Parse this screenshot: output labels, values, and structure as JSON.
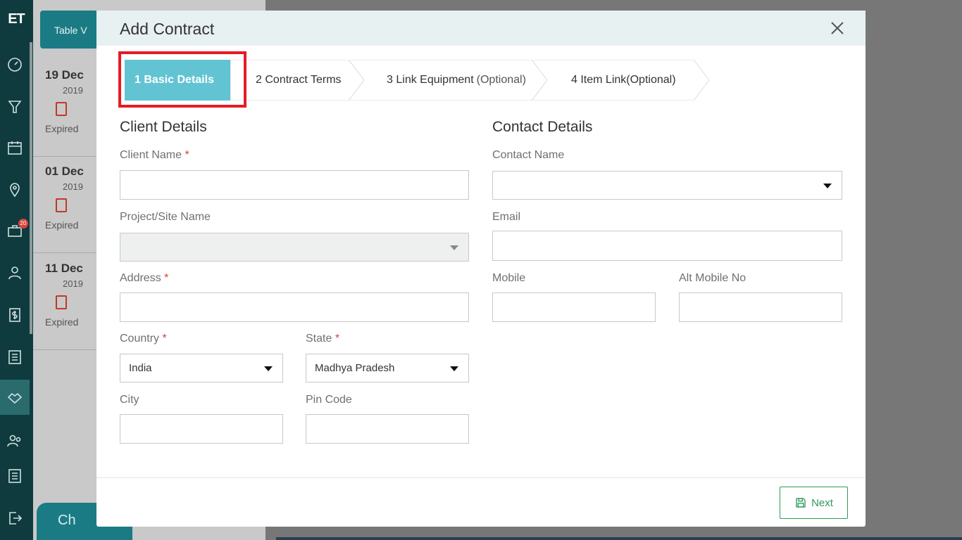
{
  "app": {
    "logo": "ET",
    "table_view_label": "Table V",
    "chat_label": "Ch",
    "notification_count": "20"
  },
  "cards": [
    {
      "date": "19 Dec",
      "year": "2019",
      "status": "Expired"
    },
    {
      "date": "01 Dec",
      "year": "2019",
      "status": "Expired"
    },
    {
      "date": "11 Dec",
      "year": "2019",
      "status": "Expired"
    }
  ],
  "modal": {
    "title": "Add Contract",
    "steps": [
      {
        "num": "1",
        "label": "Basic Details",
        "optional": ""
      },
      {
        "num": "2",
        "label": "Contract Terms",
        "optional": ""
      },
      {
        "num": "3",
        "label": "Link Equipment",
        "optional": "(Optional)"
      },
      {
        "num": "4",
        "label": "Item Link",
        "optional": "(Optional)"
      }
    ],
    "client": {
      "title": "Client Details",
      "client_name_label": "Client Name",
      "client_name_value": "",
      "project_label": "Project/Site Name",
      "project_value": "",
      "address_label": "Address",
      "address_value": "",
      "country_label": "Country",
      "country_value": "India",
      "state_label": "State",
      "state_value": "Madhya Pradesh",
      "city_label": "City",
      "city_value": "",
      "pin_label": "Pin Code",
      "pin_value": ""
    },
    "contact": {
      "title": "Contact Details",
      "contact_name_label": "Contact Name",
      "contact_name_value": "",
      "email_label": "Email",
      "email_value": "",
      "mobile_label": "Mobile",
      "mobile_value": "",
      "alt_mobile_label": "Alt Mobile No",
      "alt_mobile_value": ""
    },
    "required_mark": "*",
    "next_label": "Next"
  },
  "colors": {
    "accent": "#62c4d3",
    "nav": "#0f3b3e",
    "required": "#e53935",
    "next": "#2e9a5a",
    "highlight": "#e51b24"
  }
}
